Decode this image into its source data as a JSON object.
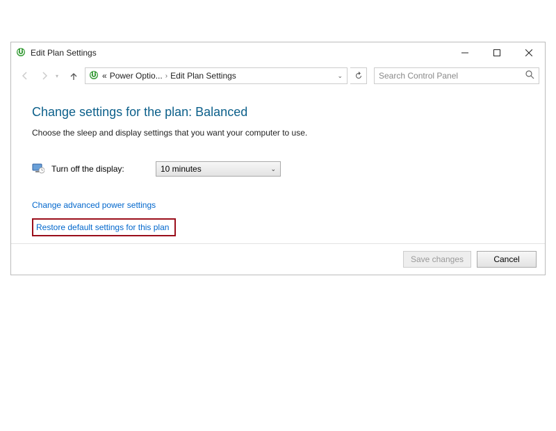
{
  "window": {
    "title": "Edit Plan Settings"
  },
  "breadcrumb": {
    "root_label": "«",
    "level1": "Power Optio...",
    "level2": "Edit Plan Settings"
  },
  "search": {
    "placeholder": "Search Control Panel"
  },
  "page": {
    "title": "Change settings for the plan: Balanced",
    "description": "Choose the sleep and display settings that you want your computer to use."
  },
  "setting": {
    "turn_off_display_label": "Turn off the display:",
    "turn_off_display_value": "10 minutes"
  },
  "links": {
    "advanced": "Change advanced power settings",
    "restore": "Restore default settings for this plan"
  },
  "footer": {
    "save": "Save changes",
    "cancel": "Cancel"
  }
}
